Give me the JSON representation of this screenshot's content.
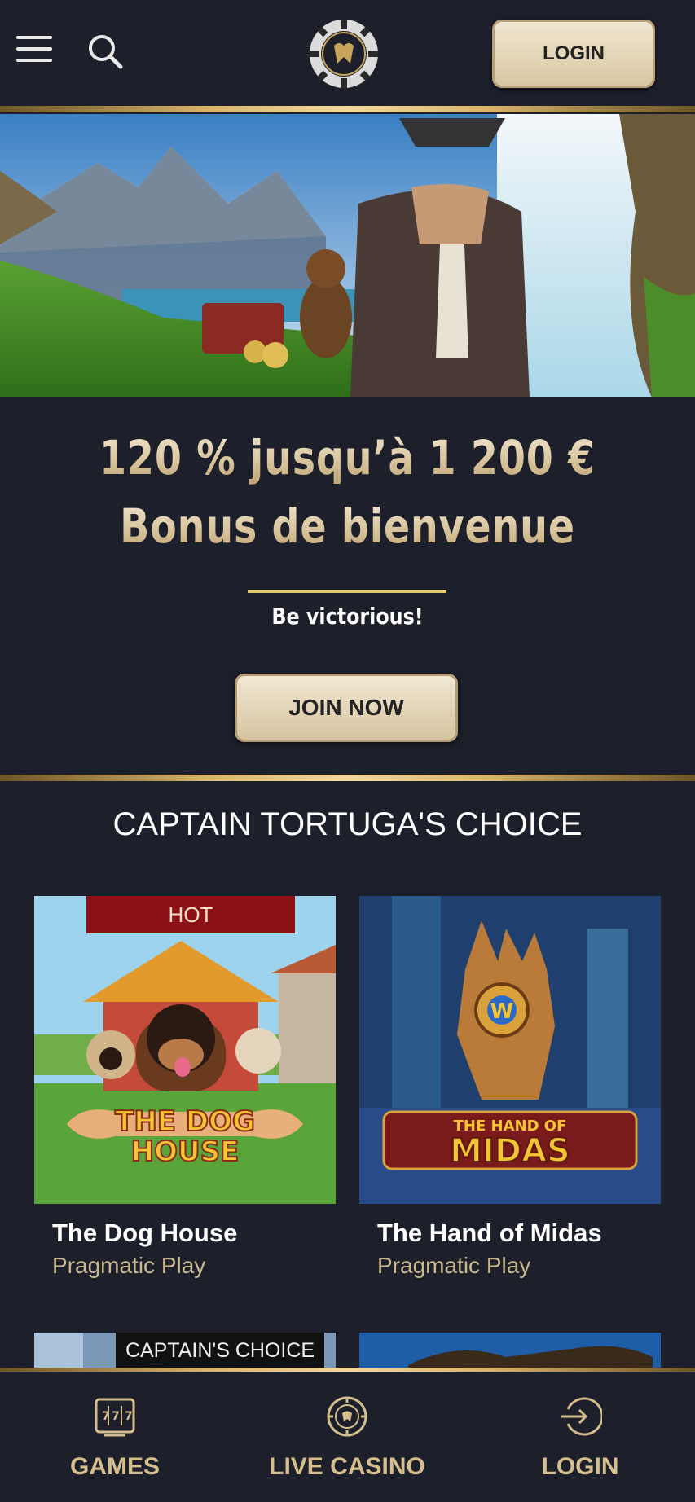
{
  "header": {
    "login_label": "LOGIN"
  },
  "hero": {
    "bonus_line1": "120 % jusqu’à 1 200 €",
    "bonus_line2": "Bonus de bienvenue",
    "tagline": "Be victorious!",
    "join_label": "JOIN NOW"
  },
  "section": {
    "title": "CAPTAIN TORTUGA'S CHOICE"
  },
  "games": [
    {
      "name": "The Dog House",
      "provider": "Pragmatic Play",
      "badge": "HOT",
      "logo_line1": "THE DOG",
      "logo_line2": "HOUSE"
    },
    {
      "name": "The Hand of Midas",
      "provider": "Pragmatic Play",
      "logo_line1": "THE HAND OF",
      "logo_line2": "MIDAS"
    }
  ],
  "row2": {
    "badge": "CAPTAIN'S CHOICE"
  },
  "bottom_nav": [
    {
      "label": "GAMES",
      "icon": "slot-machine-icon"
    },
    {
      "label": "LIVE CASINO",
      "icon": "casino-chip-icon"
    },
    {
      "label": "LOGIN",
      "icon": "login-arrow-icon"
    }
  ],
  "colors": {
    "background": "#1d202b",
    "gold": "#d9b46a",
    "button": "#e5d6b7",
    "provider_text": "#c9b88d",
    "hot_badge": "#8b1114"
  }
}
